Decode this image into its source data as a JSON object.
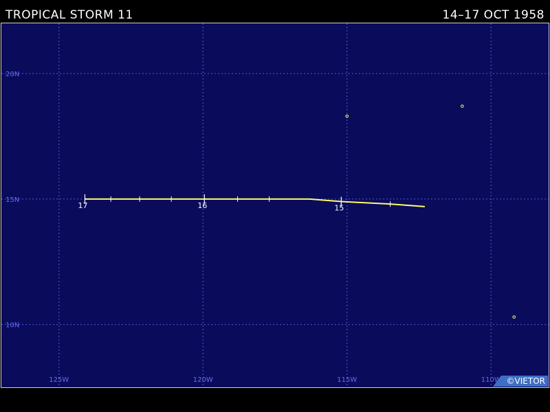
{
  "header": {
    "title": "TROPICAL STORM 11",
    "dates": "14–17 OCT 1958"
  },
  "map": {
    "background_color": "#0b0b5c",
    "grid_color": "#4b5bd6",
    "track_color": "#ffff66",
    "lon_range": [
      -127,
      -108
    ],
    "lat_range": [
      7.5,
      22
    ],
    "lat_lines": [
      {
        "value": 20,
        "label": "20N"
      },
      {
        "value": 15,
        "label": "15N"
      },
      {
        "value": 10,
        "label": "10N"
      }
    ],
    "lon_lines": [
      {
        "value": -125,
        "label": "125W"
      },
      {
        "value": -120,
        "label": "120W"
      },
      {
        "value": -115,
        "label": "115W"
      },
      {
        "value": -110,
        "label": "110W"
      }
    ],
    "track": [
      {
        "lon": -112.3,
        "lat": 14.7
      },
      {
        "lon": -113.5,
        "lat": 14.8
      },
      {
        "lon": -115.2,
        "lat": 14.9
      },
      {
        "lon": -116.3,
        "lat": 15.0
      },
      {
        "lon": -120.0,
        "lat": 15.0
      },
      {
        "lon": -124.1,
        "lat": 15.0
      }
    ],
    "day_marks": [
      {
        "lon": -115.2,
        "lat": 14.9,
        "label": "15"
      },
      {
        "lon": -119.95,
        "lat": 15.0,
        "label": "16"
      },
      {
        "lon": -124.1,
        "lat": 15.0,
        "label": "17"
      }
    ],
    "six_hour_ticks": [
      {
        "lon": -113.5,
        "lat": 14.8
      },
      {
        "lon": -123.2,
        "lat": 15.0
      },
      {
        "lon": -122.2,
        "lat": 15.0
      },
      {
        "lon": -121.1,
        "lat": 15.0
      },
      {
        "lon": -118.8,
        "lat": 15.0
      },
      {
        "lon": -117.7,
        "lat": 15.0
      }
    ],
    "islands": [
      {
        "lon": -115.0,
        "lat": 18.3
      },
      {
        "lon": -111.0,
        "lat": 18.7
      },
      {
        "lon": -109.2,
        "lat": 10.3
      }
    ]
  },
  "credit": "©VIETOR"
}
